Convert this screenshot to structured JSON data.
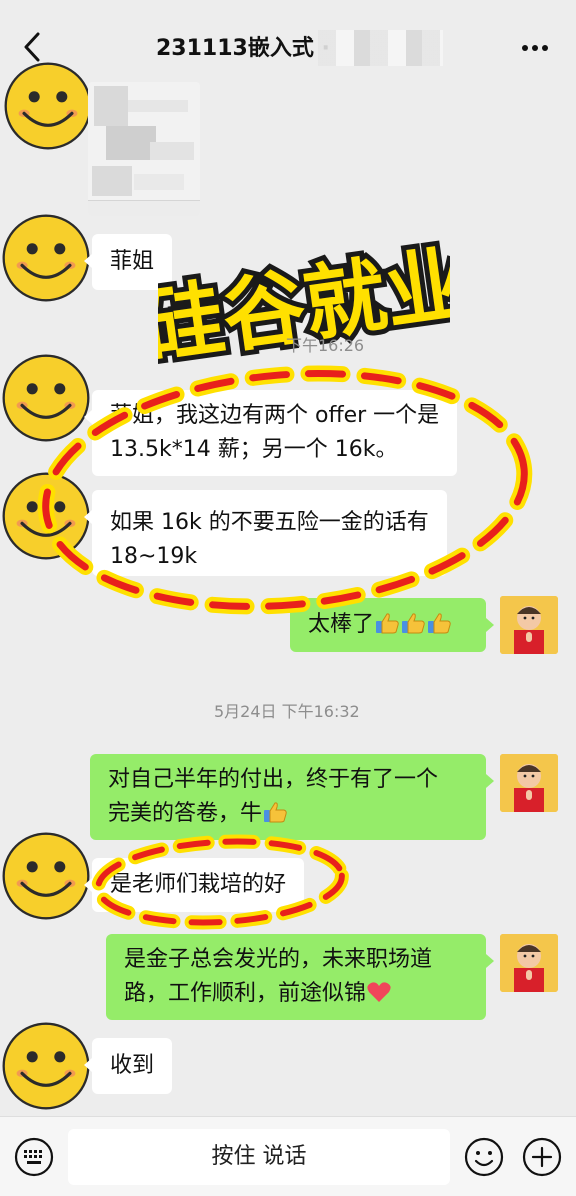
{
  "header": {
    "title": "231113嵌入式",
    "title_suffix": "·"
  },
  "stamp_text": "硅谷就业",
  "messages": [
    {
      "id": "m1",
      "side": "in",
      "text": "菲姐"
    },
    {
      "id": "m2",
      "side": "in",
      "lines": [
        "菲姐，我这边有两个 offer 一个是",
        "13.5k*14 薪；另一个 16k。"
      ]
    },
    {
      "id": "m3",
      "side": "in",
      "lines": [
        "如果 16k 的不要五险一金的话有",
        "18~19k"
      ]
    },
    {
      "id": "m4",
      "side": "out",
      "text": "太棒了"
    },
    {
      "id": "m5",
      "side": "out",
      "lines": [
        "对自己半年的付出，终于有了一个",
        "完美的答卷，牛"
      ]
    },
    {
      "id": "m6",
      "side": "in",
      "text": "是老师们栽培的好"
    },
    {
      "id": "m7",
      "side": "out",
      "lines": [
        "是金子总会发光的，未来职场道",
        "路，工作顺利，前途似锦"
      ]
    },
    {
      "id": "m8",
      "side": "in",
      "text": "收到"
    }
  ],
  "timestamps": {
    "t1": "下午16:26",
    "t2": "5月24日 下午16:32"
  },
  "input_bar": {
    "hold_to_talk": "按住 说话"
  },
  "icons": {
    "back": "back-arrow-icon",
    "more": "more-dots-icon",
    "keyboard": "keyboard-icon",
    "emoji": "emoji-icon",
    "plus": "plus-icon",
    "thumb": "thumbs-up-emoji",
    "heart": "heart-emoji"
  },
  "colors": {
    "background": "#ededed",
    "incoming_bubble": "#ffffff",
    "outgoing_bubble": "#95ec69",
    "stamp_yellow": "#ffe000",
    "dash_red": "#e8201c"
  }
}
